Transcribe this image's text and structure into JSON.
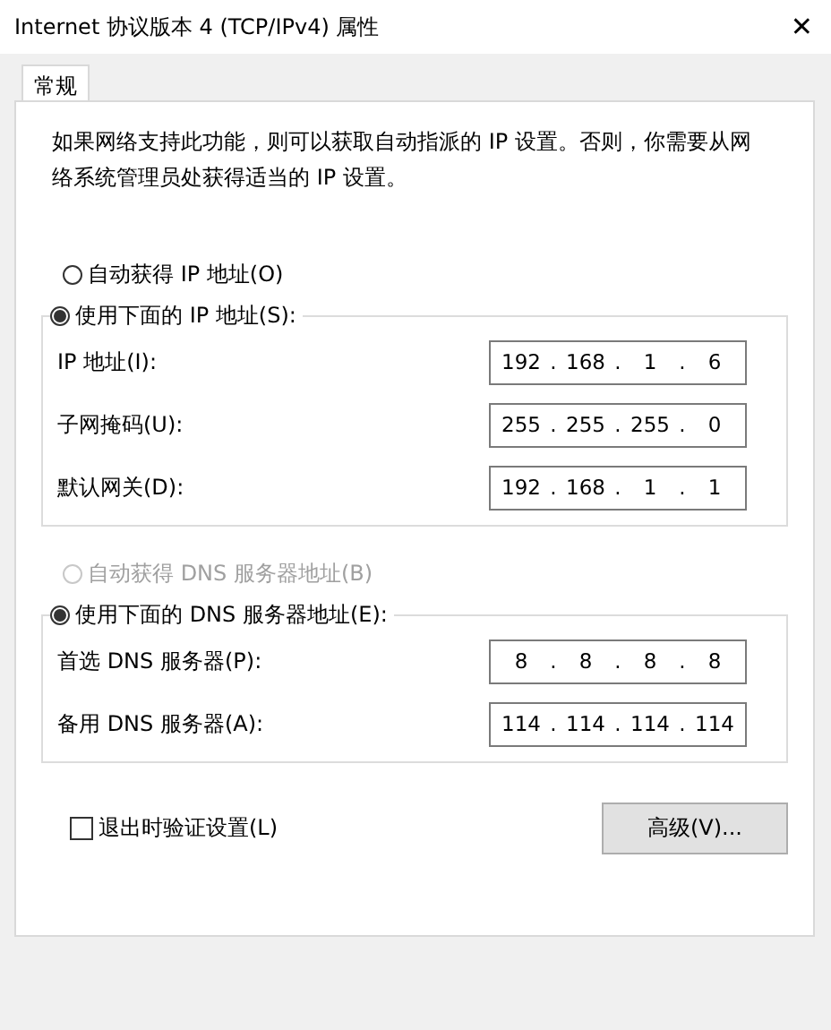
{
  "window": {
    "title": "Internet 协议版本 4 (TCP/IPv4) 属性",
    "close": "✕"
  },
  "tabs": [
    {
      "label": "常规",
      "selected": true
    }
  ],
  "description": "如果网络支持此功能，则可以获取自动指派的 IP 设置。否则，你需要从网络系统管理员处获得适当的 IP 设置。",
  "ip_auto": {
    "label": "自动获得 IP 地址(O)",
    "selected": false,
    "disabled": false
  },
  "ip_manual": {
    "label": "使用下面的 IP 地址(S):",
    "selected": true,
    "disabled": false,
    "fields": [
      {
        "label": "IP 地址(I):",
        "octets": [
          "192",
          "168",
          "1",
          "6"
        ]
      },
      {
        "label": "子网掩码(U):",
        "octets": [
          "255",
          "255",
          "255",
          "0"
        ]
      },
      {
        "label": "默认网关(D):",
        "octets": [
          "192",
          "168",
          "1",
          "1"
        ]
      }
    ]
  },
  "dns_auto": {
    "label": "自动获得 DNS 服务器地址(B)",
    "selected": false,
    "disabled": true
  },
  "dns_manual": {
    "label": "使用下面的 DNS 服务器地址(E):",
    "selected": true,
    "disabled": false,
    "fields": [
      {
        "label": "首选 DNS 服务器(P):",
        "octets": [
          "8",
          "8",
          "8",
          "8"
        ]
      },
      {
        "label": "备用 DNS 服务器(A):",
        "octets": [
          "114",
          "114",
          "114",
          "114"
        ]
      }
    ]
  },
  "separator": ".",
  "validate": {
    "label": "退出时验证设置(L)",
    "checked": false
  },
  "advanced_button": "高级(V)..."
}
